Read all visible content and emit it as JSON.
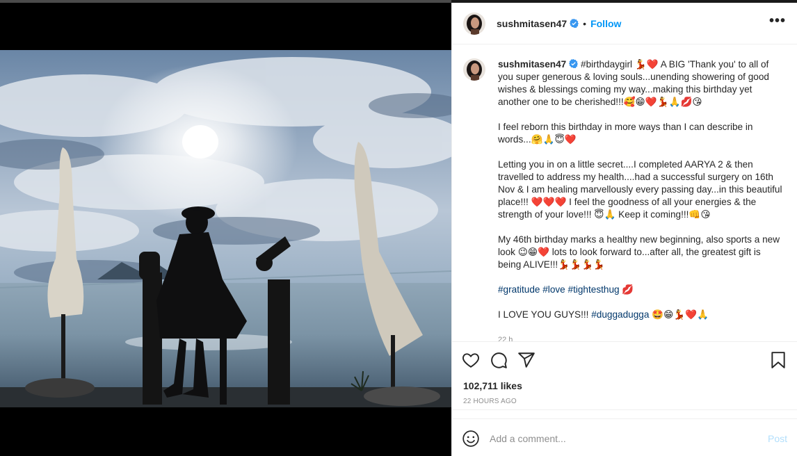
{
  "post": {
    "username": "sushmitasen47",
    "follow_label": "Follow",
    "dot": "•",
    "more_label": "•••"
  },
  "caption": {
    "username": "sushmitasen47",
    "p1": "#birthdaygirl 💃❤️ A BIG 'Thank you' to all of you super generous & loving souls...unending showering of good wishes & blessings coming my way...making this birthday yet another one to be cherished!!!🥰😁❤️💃🙏💋😘",
    "p2": "I feel reborn this birthday in more ways than I can describe in words...🤗🙏😇❤️",
    "p3": "Letting you in on a little secret....I completed AARYA 2 & then travelled to address my health....had a successful surgery on 16th Nov & I am healing marvellously every passing day...in this beautiful place!!! ❤️❤️❤️ I feel the goodness of all your energies & the strength of your love!!! 😇🙏 Keep it coming!!!👊😘",
    "p4": "My 46th birthday marks a healthy new beginning, also sports a new look 😉😁❤️ lots to look forward to...after all, the greatest gift is being ALIVE!!!💃💃💃💃",
    "p5_tags": "#gratitude #love #tightesthug",
    "p5_emoji": " 💋",
    "p6_text": "I LOVE YOU GUYS!!! ",
    "p6_tag": "#duggadugga",
    "p6_emoji": " 🤩😁💃❤️🙏",
    "partial_time": "22 h"
  },
  "stats": {
    "likes": "102,711 likes",
    "time": "22 HOURS AGO"
  },
  "comment": {
    "placeholder": "Add a comment...",
    "post_label": "Post"
  },
  "icons": {
    "like": "heart-icon",
    "comment": "comment-bubble-icon",
    "share": "paper-plane-icon",
    "save": "bookmark-icon",
    "emoji": "smiley-icon",
    "verified": "verified-badge-icon",
    "more": "more-options-icon"
  },
  "colors": {
    "accent": "#0095f6",
    "verified": "#3897f0",
    "hashtag": "#00376b",
    "post_disabled": "#b2dffc",
    "muted": "#8e8e8e"
  }
}
